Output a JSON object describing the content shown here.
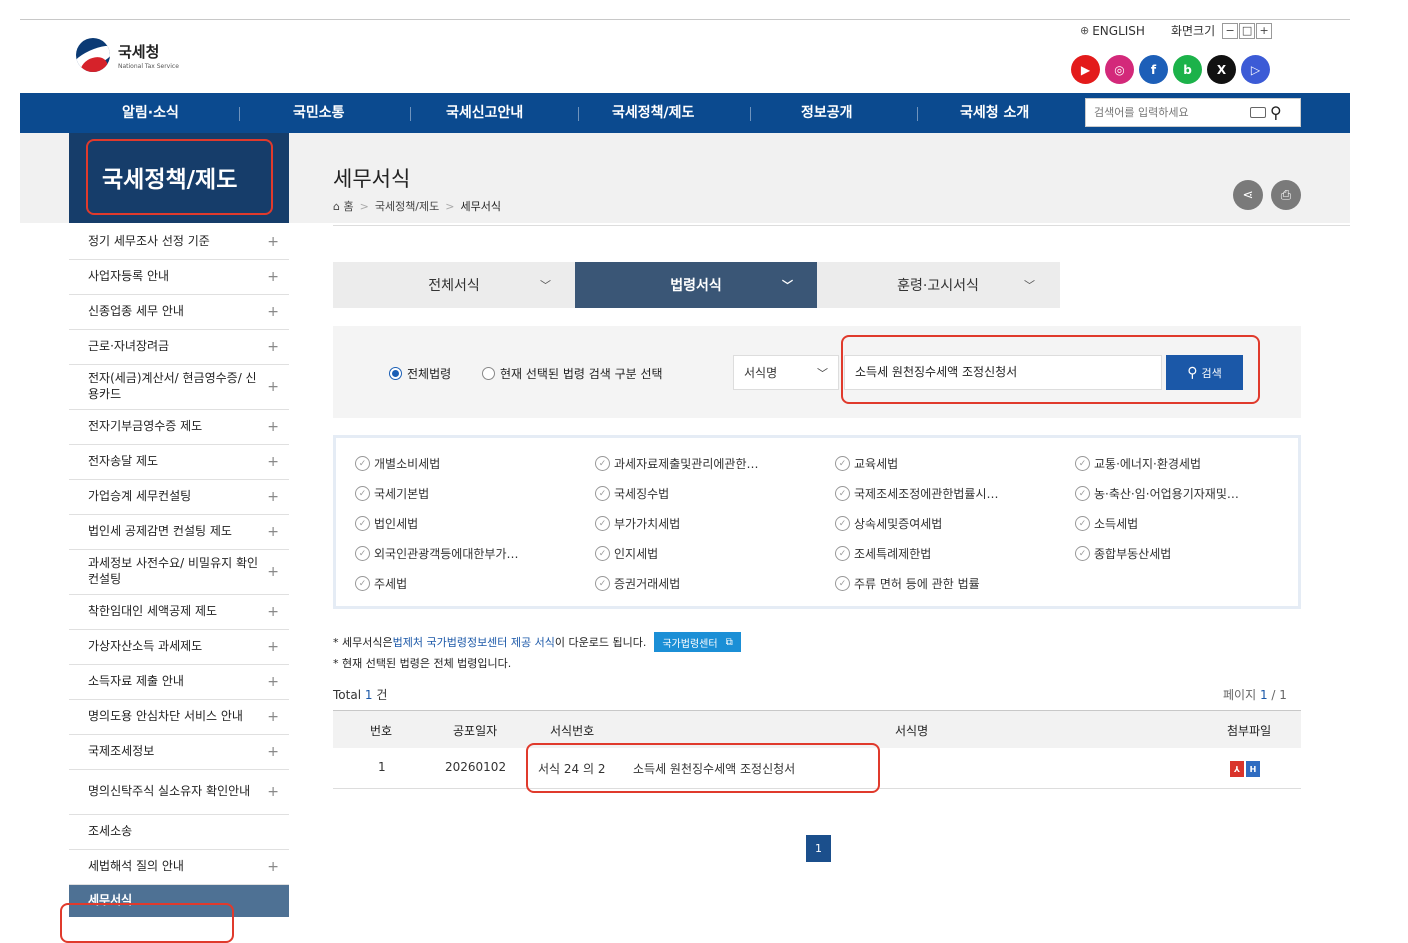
{
  "header": {
    "logo_ko": "국세청",
    "logo_en": "National Tax Service",
    "english_label": "ENGLISH",
    "screen_size_label": "화면크기",
    "zoom_out": "−",
    "zoom_reset": "□",
    "zoom_in": "+",
    "sns": [
      {
        "name": "youtube",
        "glyph": "▶",
        "color": "#e31b1b"
      },
      {
        "name": "instagram",
        "glyph": "◎",
        "color": "#d3297a"
      },
      {
        "name": "facebook",
        "glyph": "f",
        "color": "#1d5fb8"
      },
      {
        "name": "blog",
        "glyph": "b",
        "color": "#1cb24a"
      },
      {
        "name": "x",
        "glyph": "X",
        "color": "#111111"
      },
      {
        "name": "tv",
        "glyph": "▷",
        "color": "#3c5bd6"
      }
    ]
  },
  "nav": {
    "items": [
      "알림·소식",
      "국민소통",
      "국세신고안내",
      "국세정책/제도",
      "정보공개",
      "국세청 소개"
    ],
    "search_placeholder": "검색어를 입력하세요"
  },
  "sidebar": {
    "title": "국세정책/제도",
    "items": [
      {
        "label": "정기 세무조사 선정 기준",
        "plus": "+"
      },
      {
        "label": "사업자등록 안내",
        "plus": "+"
      },
      {
        "label": "신종업종 세무 안내",
        "plus": "+"
      },
      {
        "label": "근로·자녀장려금",
        "plus": "+"
      },
      {
        "label": "전자(세금)계산서/ 현금영수증/ 신용카드",
        "plus": "+"
      },
      {
        "label": "전자기부금영수증 제도",
        "plus": "+"
      },
      {
        "label": "전자송달 제도",
        "plus": "+"
      },
      {
        "label": "가업승계 세무컨설팅",
        "plus": "+"
      },
      {
        "label": "법인세 공제감면 컨설팅 제도",
        "plus": "+"
      },
      {
        "label": "과세정보 사전수요/ 비밀유지 확인 컨설팅",
        "plus": "+"
      },
      {
        "label": "착한임대인 세액공제 제도",
        "plus": "+"
      },
      {
        "label": "가상자산소득 과세제도",
        "plus": "+"
      },
      {
        "label": "소득자료 제출 안내",
        "plus": "+"
      },
      {
        "label": "명의도용 안심차단 서비스 안내",
        "plus": "+"
      },
      {
        "label": "국제조세정보",
        "plus": "+"
      },
      {
        "label": "명의신탁주식 실소유자 확인안내",
        "plus": "+"
      },
      {
        "label": "조세소송",
        "plus": ""
      },
      {
        "label": "세법해석 질의 안내",
        "plus": "+"
      },
      {
        "label": "세무서식",
        "plus": ""
      }
    ]
  },
  "page": {
    "title": "세무서식",
    "breadcrumb": {
      "home": "홈",
      "sep": ">",
      "level1": "국세정책/제도",
      "current": "세무서식"
    }
  },
  "tabs": [
    {
      "label": "전체서식",
      "active": false
    },
    {
      "label": "법령서식",
      "active": true
    },
    {
      "label": "훈령·고시서식",
      "active": false
    }
  ],
  "search": {
    "radio_all": "전체법령",
    "radio_selected": "현재 선택된 법령 검색 구분 선택",
    "field_select": "서식명",
    "query": "소득세 원천징수세액 조정신청서",
    "button": "검색"
  },
  "laws": [
    "개별소비세법",
    "과세자료제출및관리에관한…",
    "교육세법",
    "교통·에너지·환경세법",
    "국세기본법",
    "국세징수법",
    "국제조세조정에관한법률시…",
    "농·축산·임·어업용기자재및…",
    "법인세법",
    "부가가치세법",
    "상속세및증여세법",
    "소득세법",
    "외국인관광객등에대한부가…",
    "인지세법",
    "조세특례제한법",
    "종합부동산세법",
    "주세법",
    "증권거래세법",
    "주류 면허 등에 관한 법률"
  ],
  "notes": {
    "line1_pre": "* 세무서식은 ",
    "line1_link": "법제처 국가법령정보센터 제공 서식",
    "line1_post": "이 다운로드 됩니다.",
    "law_center_btn": "국가법령센터",
    "line2": "* 현재 선택된 법령은 전체 법령입니다."
  },
  "results": {
    "total_label": "Total",
    "total": "1",
    "total_unit": "건",
    "page_label": "페이지",
    "page_cur": "1",
    "page_total": "/ 1",
    "columns": [
      "번호",
      "공포일자",
      "서식번호",
      "서식명",
      "첨부파일"
    ],
    "rows": [
      {
        "no": "1",
        "date": "20260102",
        "form_no": "서식 24 의 2",
        "form_name": "소득세 원천징수세액 조정신청서"
      }
    ]
  },
  "pagination": [
    "1"
  ]
}
